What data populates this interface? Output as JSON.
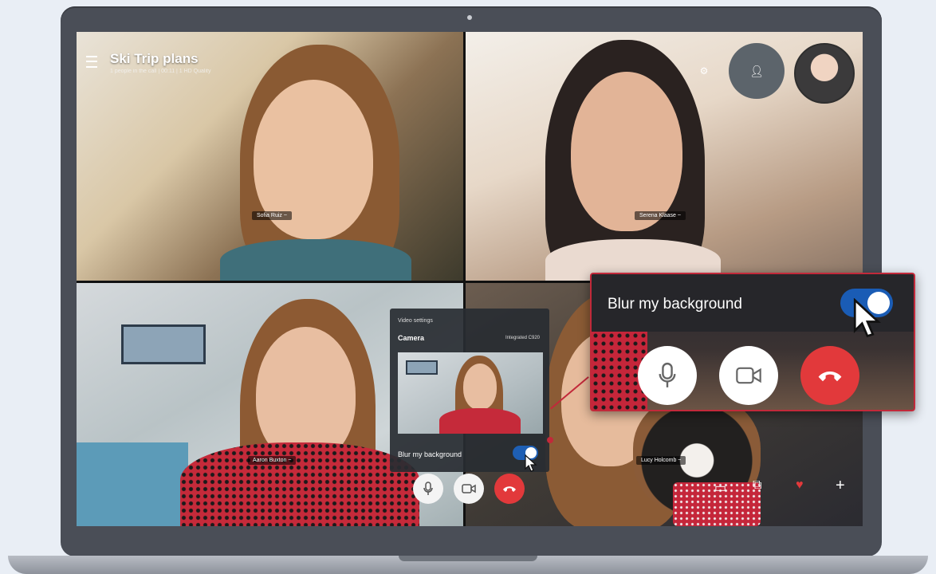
{
  "call": {
    "title": "Ski Trip plans",
    "subtitle": "1 people in the call | 00:11 | 1 HD Quality"
  },
  "participants": [
    {
      "name": "Sofia Ruiz",
      "tag": "Sofia Ruiz ~"
    },
    {
      "name": "Serena Klaase",
      "tag": "Serena Klaase ~"
    },
    {
      "name": "Aaron Buxton",
      "tag": "Aaron Buxton ~"
    },
    {
      "name": "Lucy Holcomb",
      "tag": "Lucy Holcomb ~"
    }
  ],
  "video_settings": {
    "title": "Video settings",
    "section": "Camera",
    "device": "Integrated C920",
    "blur_label": "Blur my background",
    "blur_enabled": true
  },
  "zoom_callout": {
    "label": "Blur my background",
    "blur_enabled": true
  },
  "icons": {
    "menu": "hamburger-icon",
    "settings": "settings-icon",
    "add_person": "add-person-icon",
    "mic": "microphone-icon",
    "camera": "video-camera-icon",
    "end_call": "end-call-icon",
    "chat": "chat-icon",
    "switch": "switch-camera-icon",
    "heart": "heart-icon",
    "plus": "plus-icon"
  },
  "colors": {
    "end_call": "#e2393b",
    "toggle_on": "#1a5cb5",
    "callout_border": "#c2293a"
  }
}
